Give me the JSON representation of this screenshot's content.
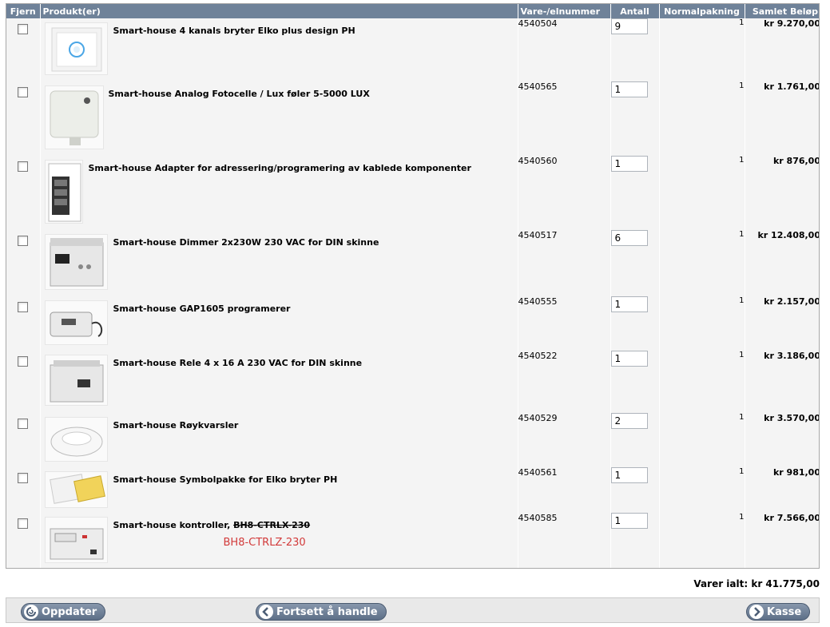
{
  "table": {
    "headers": {
      "remove": "Fjern",
      "product": "Produkt(er)",
      "item_number": "Vare-/elnummer",
      "quantity": "Antall",
      "normal_pack": "Normalpakning",
      "total": "Samlet Beløp"
    },
    "rows": [
      {
        "name": "Smart-house 4 kanals bryter Elko plus design PH",
        "item_number": "4540504",
        "quantity": "9",
        "pack": "1",
        "total": "kr 9.270,00",
        "icon": "wall-switch-icon"
      },
      {
        "name": "Smart-house Analog Fotocelle / Lux føler 5-5000 LUX",
        "item_number": "4540565",
        "quantity": "1",
        "pack": "1",
        "total": "kr 1.761,00",
        "icon": "light-sensor-icon"
      },
      {
        "name": "Smart-house Adapter for adressering/programering av kablede komponenter",
        "item_number": "4540560",
        "quantity": "1",
        "pack": "1",
        "total": "kr 876,00",
        "icon": "adapter-module-icon"
      },
      {
        "name": "Smart-house Dimmer 2x230W 230 VAC for DIN skinne",
        "item_number": "4540517",
        "quantity": "6",
        "pack": "1",
        "total": "kr 12.408,00",
        "icon": "din-dimmer-icon"
      },
      {
        "name": "Smart-house GAP1605 programerer",
        "item_number": "4540555",
        "quantity": "1",
        "pack": "1",
        "total": "kr 2.157,00",
        "icon": "programmer-device-icon"
      },
      {
        "name": "Smart-house Rele 4 x 16 A 230 VAC for DIN skinne",
        "item_number": "4540522",
        "quantity": "1",
        "pack": "1",
        "total": "kr 3.186,00",
        "icon": "din-relay-icon"
      },
      {
        "name": "Smart-house Røykvarsler",
        "item_number": "4540529",
        "quantity": "2",
        "pack": "1",
        "total": "kr 3.570,00",
        "icon": "smoke-detector-icon"
      },
      {
        "name": "Smart-house Symbolpakke for Elko bryter PH",
        "item_number": "4540561",
        "quantity": "1",
        "pack": "1",
        "total": "kr 981,00",
        "icon": "symbol-pack-icon"
      },
      {
        "name": "Smart-house kontroller, ",
        "name_strike": "BH8-CTRLX-230",
        "note": "BH8-CTRLZ-230",
        "item_number": "4540585",
        "quantity": "1",
        "pack": "1",
        "total": "kr 7.566,00",
        "icon": "controller-unit-icon"
      }
    ]
  },
  "summary": {
    "total_label": "Varer ialt:",
    "total_value": "kr 41.775,00"
  },
  "buttons": {
    "update": "Oppdater",
    "continue": "Fortsett å handle",
    "checkout": "Kasse"
  }
}
